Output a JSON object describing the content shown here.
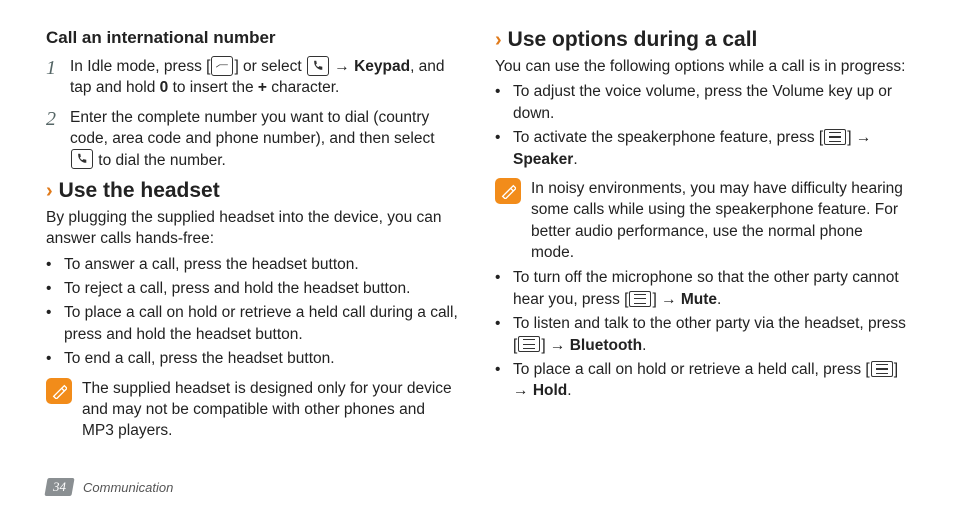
{
  "page": {
    "number": "34",
    "section": "Communication"
  },
  "left": {
    "h1": "Call an international number",
    "steps": [
      {
        "num": "1",
        "parts": [
          "In Idle mode, press [",
          "] or select ",
          " → ",
          ", and tap and hold ",
          " to insert the ",
          " character."
        ],
        "bold": {
          "keypad": "Keypad",
          "zero": "0",
          "plus": "+"
        }
      },
      {
        "num": "2",
        "parts": [
          "Enter the complete number you want to dial (country code, area code and phone number), and then select ",
          " to dial the number."
        ]
      }
    ],
    "h2": "Use the headset",
    "intro": "By plugging the supplied headset into the device, you can answer calls hands-free:",
    "bullets": [
      "To answer a call, press the headset button.",
      "To reject a call, press and hold the headset button.",
      "To place a call on hold or retrieve a held call during a call, press and hold the headset button.",
      "To end a call, press the headset button."
    ],
    "note": "The supplied headset is designed only for your device and may not be compatible with other phones and MP3 players."
  },
  "right": {
    "h1": "Use options during a call",
    "intro": "You can use the following options while a call is in progress:",
    "bullets": [
      {
        "t": "To adjust the voice volume, press the Volume key up or down."
      },
      {
        "pre": "To activate the speakerphone feature, press [",
        "post": "] → ",
        "bold": "Speaker",
        "tail": "."
      }
    ],
    "note": "In noisy environments, you may have difficulty hearing some calls while using the speakerphone feature. For better audio performance, use the normal phone mode.",
    "bullets2": [
      {
        "pre": "To turn off the microphone so that the other party cannot hear you, press [",
        "post": "] → ",
        "bold": "Mute",
        "tail": "."
      },
      {
        "pre": "To listen and talk to the other party via the headset, press [",
        "post": "] → ",
        "bold": "Bluetooth",
        "tail": "."
      },
      {
        "pre": "To place a call on hold or retrieve a held call, press [",
        "post": "] → ",
        "bold": "Hold",
        "tail": "."
      }
    ]
  }
}
